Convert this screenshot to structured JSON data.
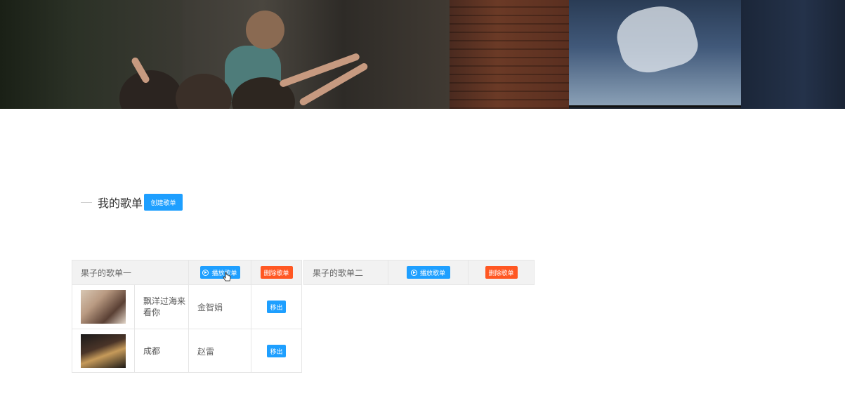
{
  "section": {
    "title": "我的歌单",
    "create_button": "创建歌单"
  },
  "playlists": [
    {
      "name": "果子的歌单一",
      "play_label": "播放歌单",
      "delete_label": "删除歌单",
      "songs": [
        {
          "title": "飘洋过海来看你",
          "singer": "金智娟",
          "remove_label": "移出"
        },
        {
          "title": "成都",
          "singer": "赵雷",
          "remove_label": "移出"
        }
      ]
    },
    {
      "name": "果子的歌单二",
      "play_label": "播放歌单",
      "delete_label": "删除歌单",
      "songs": []
    }
  ],
  "colors": {
    "primary_blue": "#1e9fff",
    "danger_orange": "#ff5722",
    "header_gray": "#f2f2f2"
  },
  "icons": {
    "play": "play-circle-icon",
    "cursor": "hand-pointer-icon"
  }
}
